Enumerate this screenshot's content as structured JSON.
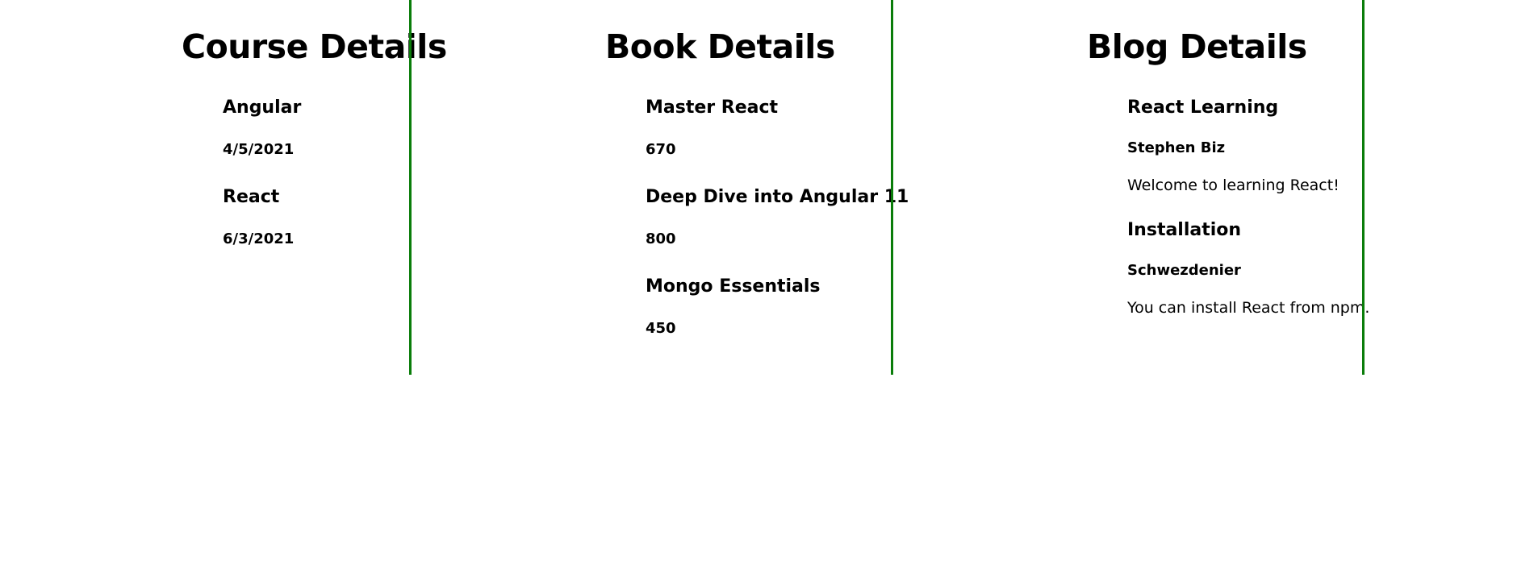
{
  "courses": {
    "title": "Course Details",
    "items": [
      {
        "name": "Angular",
        "date": "4/5/2021"
      },
      {
        "name": "React",
        "date": "6/3/2021"
      }
    ]
  },
  "books": {
    "title": "Book Details",
    "items": [
      {
        "name": "Master React",
        "price": "670"
      },
      {
        "name": "Deep Dive into Angular 11",
        "price": "800"
      },
      {
        "name": "Mongo Essentials",
        "price": "450"
      }
    ]
  },
  "blogs": {
    "title": "Blog Details",
    "items": [
      {
        "title": "React Learning",
        "author": "Stephen Biz",
        "content": "Welcome to learning React!"
      },
      {
        "title": "Installation",
        "author": "Schwezdenier",
        "content": "You can install React from npm."
      }
    ]
  },
  "colors": {
    "divider": "#0a7d0a",
    "text": "#000000",
    "background": "#ffffff"
  }
}
